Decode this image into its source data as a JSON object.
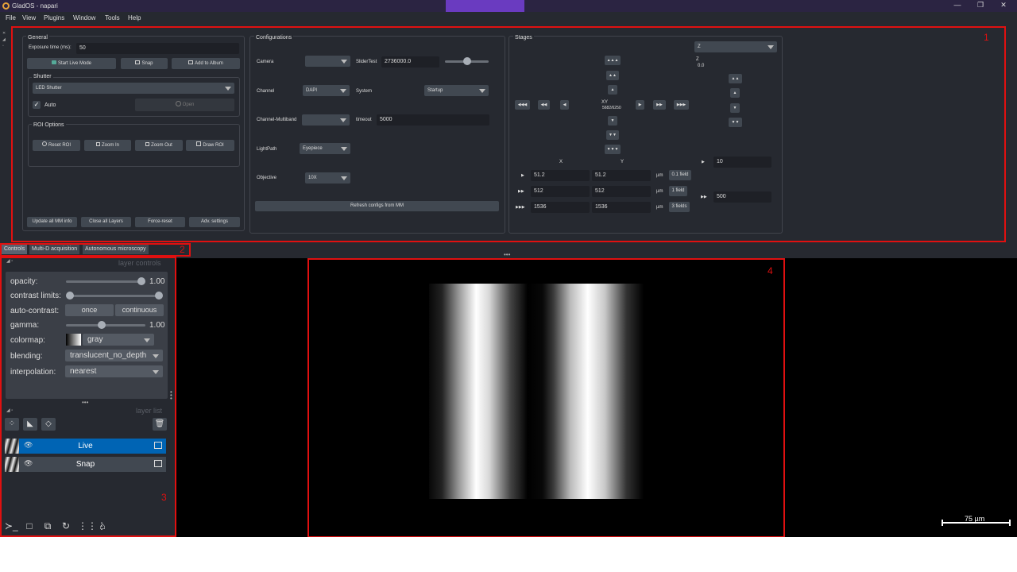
{
  "window": {
    "title": "GladOS - napari"
  },
  "window_controls": {
    "minimize": "—",
    "maximize": "❐",
    "close": "✕"
  },
  "menu": [
    "File",
    "View",
    "Plugins",
    "Window",
    "Tools",
    "Help"
  ],
  "annotations": [
    "1",
    "2",
    "3",
    "4"
  ],
  "general": {
    "title": "General",
    "exposure_label": "Exposure time (ms):",
    "exposure_value": "50",
    "live_button": "Start Live Mode",
    "snap_button": "Snap",
    "album_button": "Add to Album",
    "shutter_title": "Shutter",
    "shutter_value": "LED Shutter",
    "auto_label": "Auto",
    "auto_checked": true,
    "open_button": "Open",
    "roi_title": "ROI Options",
    "reset_roi": "Reset ROI",
    "zoom_in": "Zoom In",
    "zoom_out": "Zoom Out",
    "draw_roi": "Draw ROI",
    "update_mm": "Update all MM info",
    "close_layers": "Close all Layers",
    "force_reset": "Force-reset",
    "adv_settings": "Adv. settings"
  },
  "configurations": {
    "title": "Configurations",
    "camera_label": "Camera",
    "camera_value": "",
    "slidertest_label": "SliderTest",
    "slidertest_value": "2736000.0",
    "slidertest_level": 0.5,
    "channel_label": "Channel",
    "channel_value": "DAPI",
    "system_label": "System",
    "system_value": "Startup",
    "multiband_label": "Channel-Multiband",
    "multiband_value": "",
    "timeout_label": "timeout",
    "timeout_value": "5000",
    "lightpath_label": "LightPath",
    "lightpath_value": "Eyepiece",
    "objective_label": "Objective",
    "objective_value": "10X",
    "refresh_button": "Refresh configs from MM"
  },
  "stages": {
    "title": "Stages",
    "z_select": "Z",
    "z_label": "Z",
    "z_value": "0.0",
    "xy_label": "XY",
    "xy_value": "5682/6250",
    "up3": "▲▲▲",
    "up2": "▲▲",
    "up1": "▲",
    "down1": "▼",
    "down2": "▼▼",
    "down3": "▼▼▼",
    "left3": "◀◀◀",
    "left2": "◀◀",
    "left1": "◀",
    "right1": "▶",
    "right2": "▶▶",
    "right3": "▶▶▶",
    "zup2": "▲▲",
    "zup1": "▲",
    "zdown1": "▼",
    "zdown2": "▼▼",
    "x_header": "X",
    "y_header": "Y",
    "rows": [
      {
        "arrow": "▶",
        "x": "51.2",
        "y": "51.2",
        "unit": "µm",
        "button": "0.1 field"
      },
      {
        "arrow": "▶▶",
        "x": "512",
        "y": "512",
        "unit": "µm",
        "button": "1 field"
      },
      {
        "arrow": "▶▶▶",
        "x": "1536",
        "y": "1536",
        "unit": "µm",
        "button": "3 fields"
      }
    ],
    "z_rows": [
      {
        "arrow": "▶",
        "value": "10"
      },
      {
        "arrow": "▶▶",
        "value": "500"
      }
    ]
  },
  "tabs": [
    "Controls",
    "Multi-D acquisition",
    "Autonomous microscopy"
  ],
  "layer_controls": {
    "header": "layer controls",
    "opacity_label": "opacity:",
    "opacity_value": "1.00",
    "opacity_level": 1.0,
    "contrast_label": "contrast limits:",
    "autocontrast_label": "auto-contrast:",
    "once": "once",
    "continuous": "continuous",
    "gamma_label": "gamma:",
    "gamma_value": "1.00",
    "gamma_level": 0.45,
    "colormap_label": "colormap:",
    "colormap_value": "gray",
    "blending_label": "blending:",
    "blending_value": "translucent_no_depth",
    "interpolation_label": "interpolation:",
    "interpolation_value": "nearest"
  },
  "layer_list": {
    "header": "layer list",
    "layers": [
      {
        "name": "Live",
        "selected": true
      },
      {
        "name": "Snap",
        "selected": false
      }
    ]
  },
  "canvas": {
    "scale_bar": "75 µm",
    "handle": "•••"
  },
  "colors": {
    "background": "#262930",
    "button": "#414851",
    "selected": "#0064b4",
    "annotation": "#e01010",
    "titlebar": "#2b2442"
  }
}
